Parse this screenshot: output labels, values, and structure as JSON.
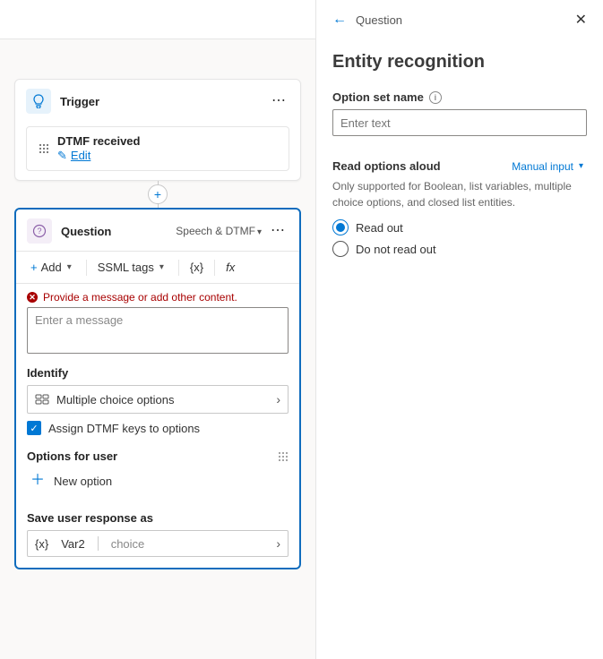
{
  "trigger": {
    "title": "Trigger",
    "event_title": "DTMF received",
    "edit_label": "Edit"
  },
  "question": {
    "title": "Question",
    "type_label": "Speech & DTMF",
    "toolbar": {
      "add": "Add",
      "ssml": "SSML tags",
      "var": "{x}",
      "fx": "fx"
    },
    "error": "Provide a message or add other content.",
    "message_placeholder": "Enter a message",
    "identify_label": "Identify",
    "identify_value": "Multiple choice options",
    "assign_label": "Assign DTMF keys to options",
    "assign_checked": true,
    "options_label": "Options for user",
    "new_option": "New option",
    "save_as_label": "Save user response as",
    "save_var": "Var2",
    "save_type": "choice"
  },
  "panel": {
    "crumb": "Question",
    "heading": "Entity recognition",
    "option_set_label": "Option set name",
    "option_set_placeholder": "Enter text",
    "read_label": "Read options aloud",
    "manual_input": "Manual input",
    "hint": "Only supported for Boolean, list variables, multiple choice options, and closed list entities.",
    "radio_read": "Read out",
    "radio_noread": "Do not read out",
    "selected": "read"
  }
}
